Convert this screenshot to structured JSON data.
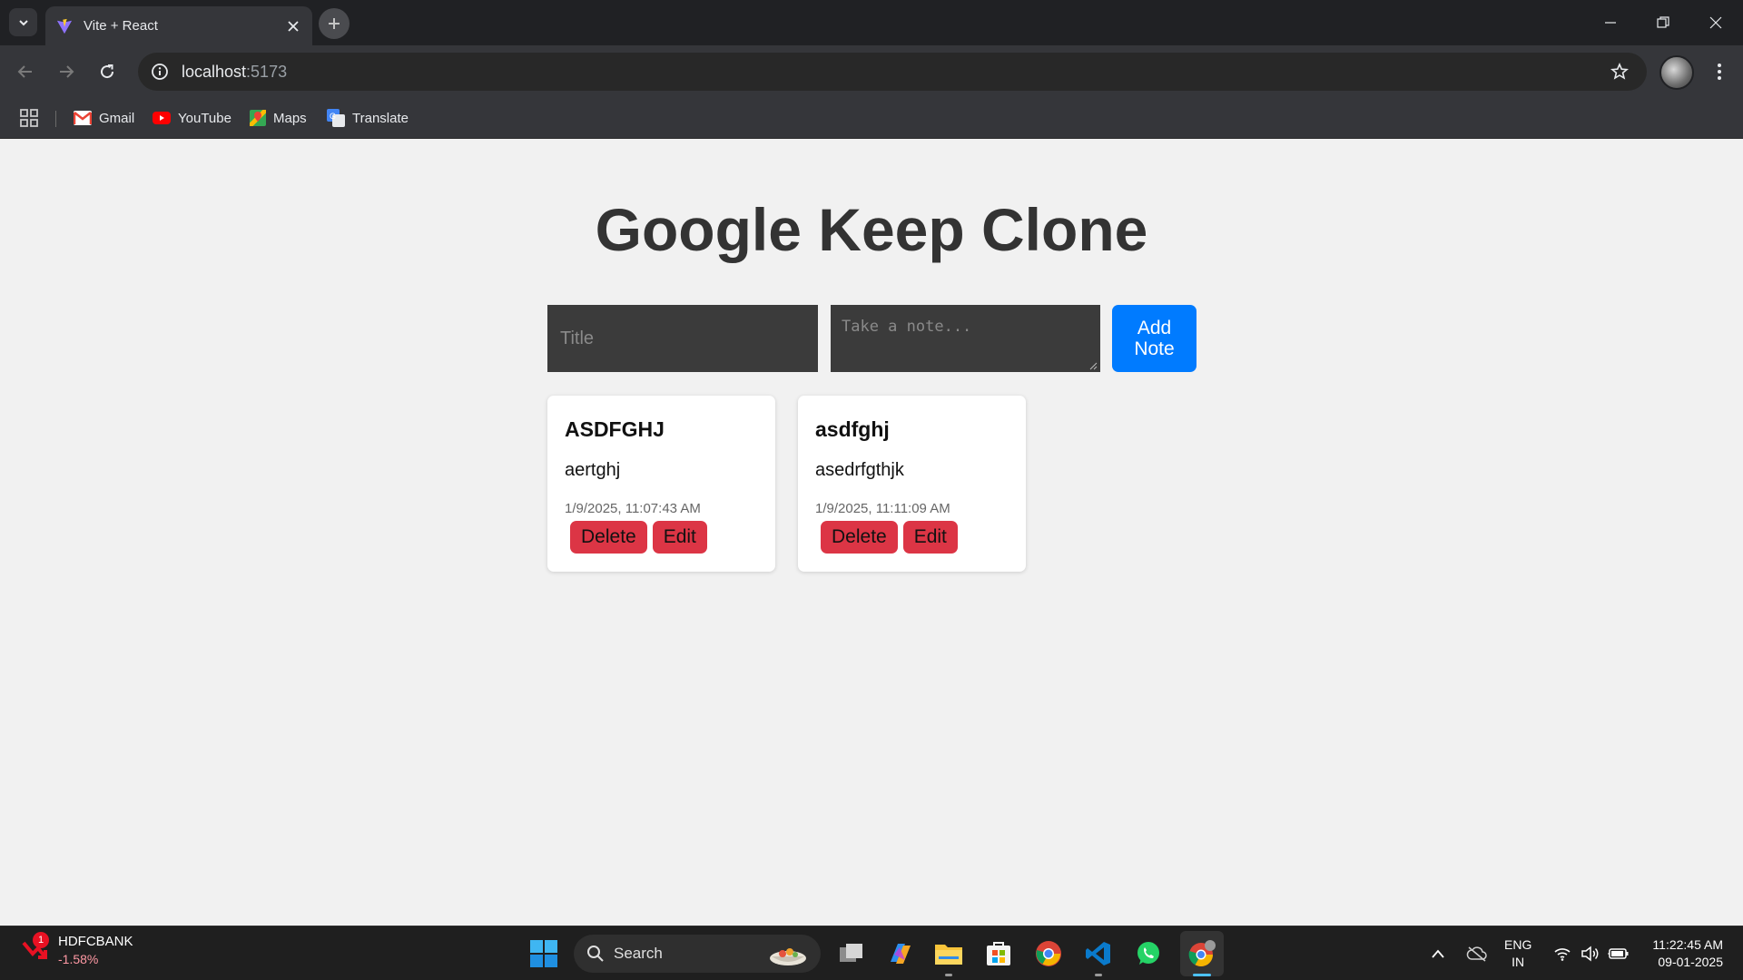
{
  "browser": {
    "tab_title": "Vite + React",
    "url_host": "localhost",
    "url_port": ":5173",
    "bookmarks": [
      {
        "label": "Gmail",
        "icon": "gmail-icon"
      },
      {
        "label": "YouTube",
        "icon": "youtube-icon"
      },
      {
        "label": "Maps",
        "icon": "maps-icon"
      },
      {
        "label": "Translate",
        "icon": "translate-icon"
      }
    ]
  },
  "app": {
    "heading": "Google Keep Clone",
    "title_placeholder": "Title",
    "note_placeholder": "Take a note...",
    "add_button": "Add Note",
    "notes": [
      {
        "title": "ASDFGHJ",
        "content": "aertghj",
        "timestamp": "1/9/2025, 11:07:43 AM",
        "delete_label": "Delete",
        "edit_label": "Edit"
      },
      {
        "title": "asdfghj",
        "content": "asedrfgthjk",
        "timestamp": "1/9/2025, 11:11:09 AM",
        "delete_label": "Delete",
        "edit_label": "Edit"
      }
    ]
  },
  "taskbar": {
    "stock_name": "HDFCBANK",
    "stock_change": "-1.58%",
    "stock_badge": "1",
    "search_label": "Search",
    "lang_line1": "ENG",
    "lang_line2": "IN",
    "time": "11:22:45 AM",
    "date": "09-01-2025"
  },
  "colors": {
    "accent_blue": "#007bff",
    "danger_red": "#dc3545",
    "page_bg": "#f1f1f1",
    "heading": "#333333"
  }
}
